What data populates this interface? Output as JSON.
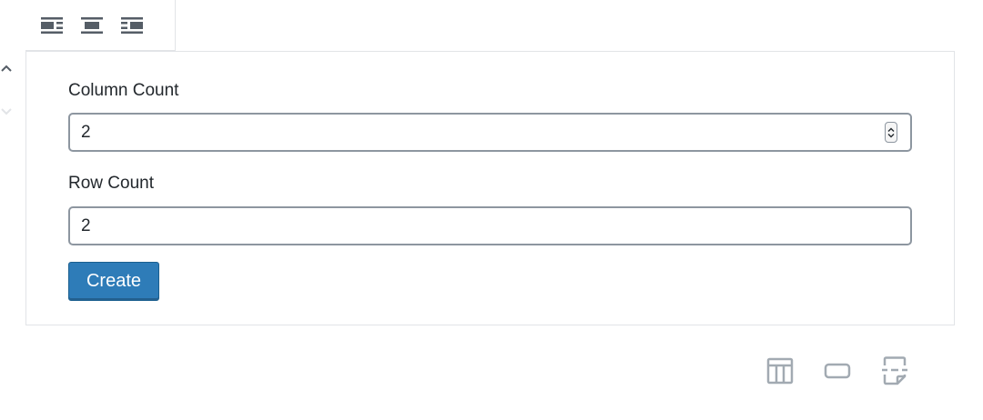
{
  "toolbar": {
    "icons": [
      "align-left-icon",
      "align-center-icon",
      "align-right-icon"
    ]
  },
  "mover": {
    "icons": [
      "chevron-up-icon",
      "chevron-down-icon"
    ]
  },
  "form": {
    "column_label": "Column Count",
    "column_value": "2",
    "row_label": "Row Count",
    "row_value": "2",
    "create_label": "Create"
  },
  "inserter": {
    "icons": [
      "table-icon",
      "button-icon",
      "page-break-icon"
    ]
  },
  "colors": {
    "icon": "#555d66",
    "icon_light": "#a2aab2",
    "button_bg": "#2e7cb8",
    "border": "#e2e4e7",
    "input_border": "#8d96a0"
  }
}
